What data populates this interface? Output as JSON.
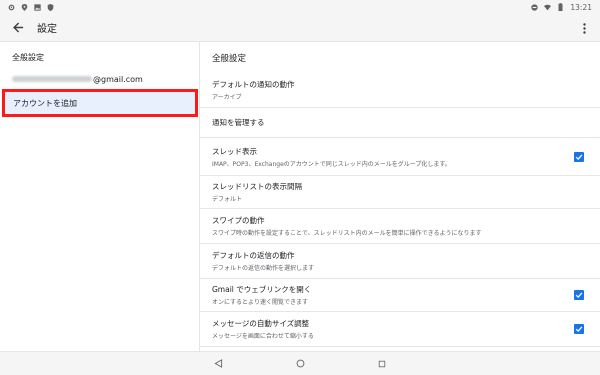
{
  "status_bar": {
    "time": "13:21"
  },
  "app_bar": {
    "title": "設定"
  },
  "sidebar": {
    "heading": "全般設定",
    "account_suffix": "@gmail.com",
    "add_account": "アカウントを追加"
  },
  "content": {
    "heading": "全般設定",
    "rows": [
      {
        "title": "デフォルトの通知の動作",
        "subtitle": "アーカイブ",
        "checked": false
      },
      {
        "title": "通知を管理する",
        "subtitle": "",
        "checked": false
      },
      {
        "title": "スレッド表示",
        "subtitle": "IMAP、POP3、Exchangeのアカウントで同じスレッド内のメールをグループ化します。",
        "checked": true
      },
      {
        "title": "スレッドリストの表示間隔",
        "subtitle": "デフォルト",
        "checked": false
      },
      {
        "title": "スワイプの動作",
        "subtitle": "スワイプ時の動作を設定することで、スレッドリスト内のメールを簡単に操作できるようになります",
        "checked": false
      },
      {
        "title": "デフォルトの返信の動作",
        "subtitle": "デフォルトの返信の動作を選択します",
        "checked": false
      },
      {
        "title": "Gmail でウェブリンクを開く",
        "subtitle": "オンにするとより速く閲覧できます",
        "checked": true
      },
      {
        "title": "メッセージの自動サイズ調整",
        "subtitle": "メッセージを画面に合わせて縮小する",
        "checked": true
      }
    ]
  },
  "colors": {
    "accent": "#1a73e8",
    "highlight_border": "#ff1a1a",
    "selected_bg": "#e8f0fe"
  },
  "icons": [
    "settings-icon",
    "location-icon",
    "image-icon",
    "shield-icon",
    "dnd-icon",
    "wifi-icon",
    "battery-icon",
    "back-arrow-icon",
    "overflow-menu-icon",
    "nav-back-icon",
    "nav-home-icon",
    "nav-recents-icon"
  ]
}
